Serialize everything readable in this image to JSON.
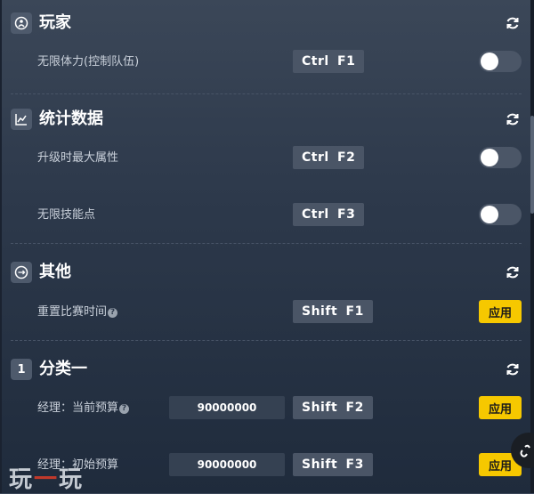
{
  "sections": [
    {
      "id": "player",
      "title": "玩家",
      "icon": "player-icon",
      "rows": [
        {
          "label": "无限体力(控制队伍)",
          "hotkey": "Ctrl  F1",
          "control": "toggle",
          "enabled": false
        }
      ]
    },
    {
      "id": "stats",
      "title": "统计数据",
      "icon": "line-chart-icon",
      "rows": [
        {
          "label": "升级时最大属性",
          "hotkey": "Ctrl  F2",
          "control": "toggle",
          "enabled": false
        },
        {
          "label": "无限技能点",
          "hotkey": "Ctrl  F3",
          "control": "toggle",
          "enabled": false
        }
      ]
    },
    {
      "id": "other",
      "title": "其他",
      "icon": "circle-arrows-icon",
      "rows": [
        {
          "label": "重置比赛时间",
          "help": "?",
          "hotkey": "Shift  F1",
          "control": "button",
          "button_label": "应用"
        }
      ]
    },
    {
      "id": "category1",
      "title": "分类一",
      "icon_text": "1",
      "rows": [
        {
          "label": "经理：当前预算",
          "help": "?",
          "value": "90000000",
          "hotkey": "Shift  F2",
          "control": "button",
          "button_label": "应用"
        },
        {
          "label": "经理：初始预算",
          "value": "90000000",
          "hotkey": "Shift  F3",
          "control": "button",
          "button_label": "应用"
        }
      ]
    }
  ],
  "watermark": {
    "part1": "玩",
    "part2": "一",
    "part3": "玩"
  },
  "colors": {
    "accent": "#f6c800",
    "toggle_off": "#4b5667",
    "hotkey_bg": "#4a5566"
  }
}
